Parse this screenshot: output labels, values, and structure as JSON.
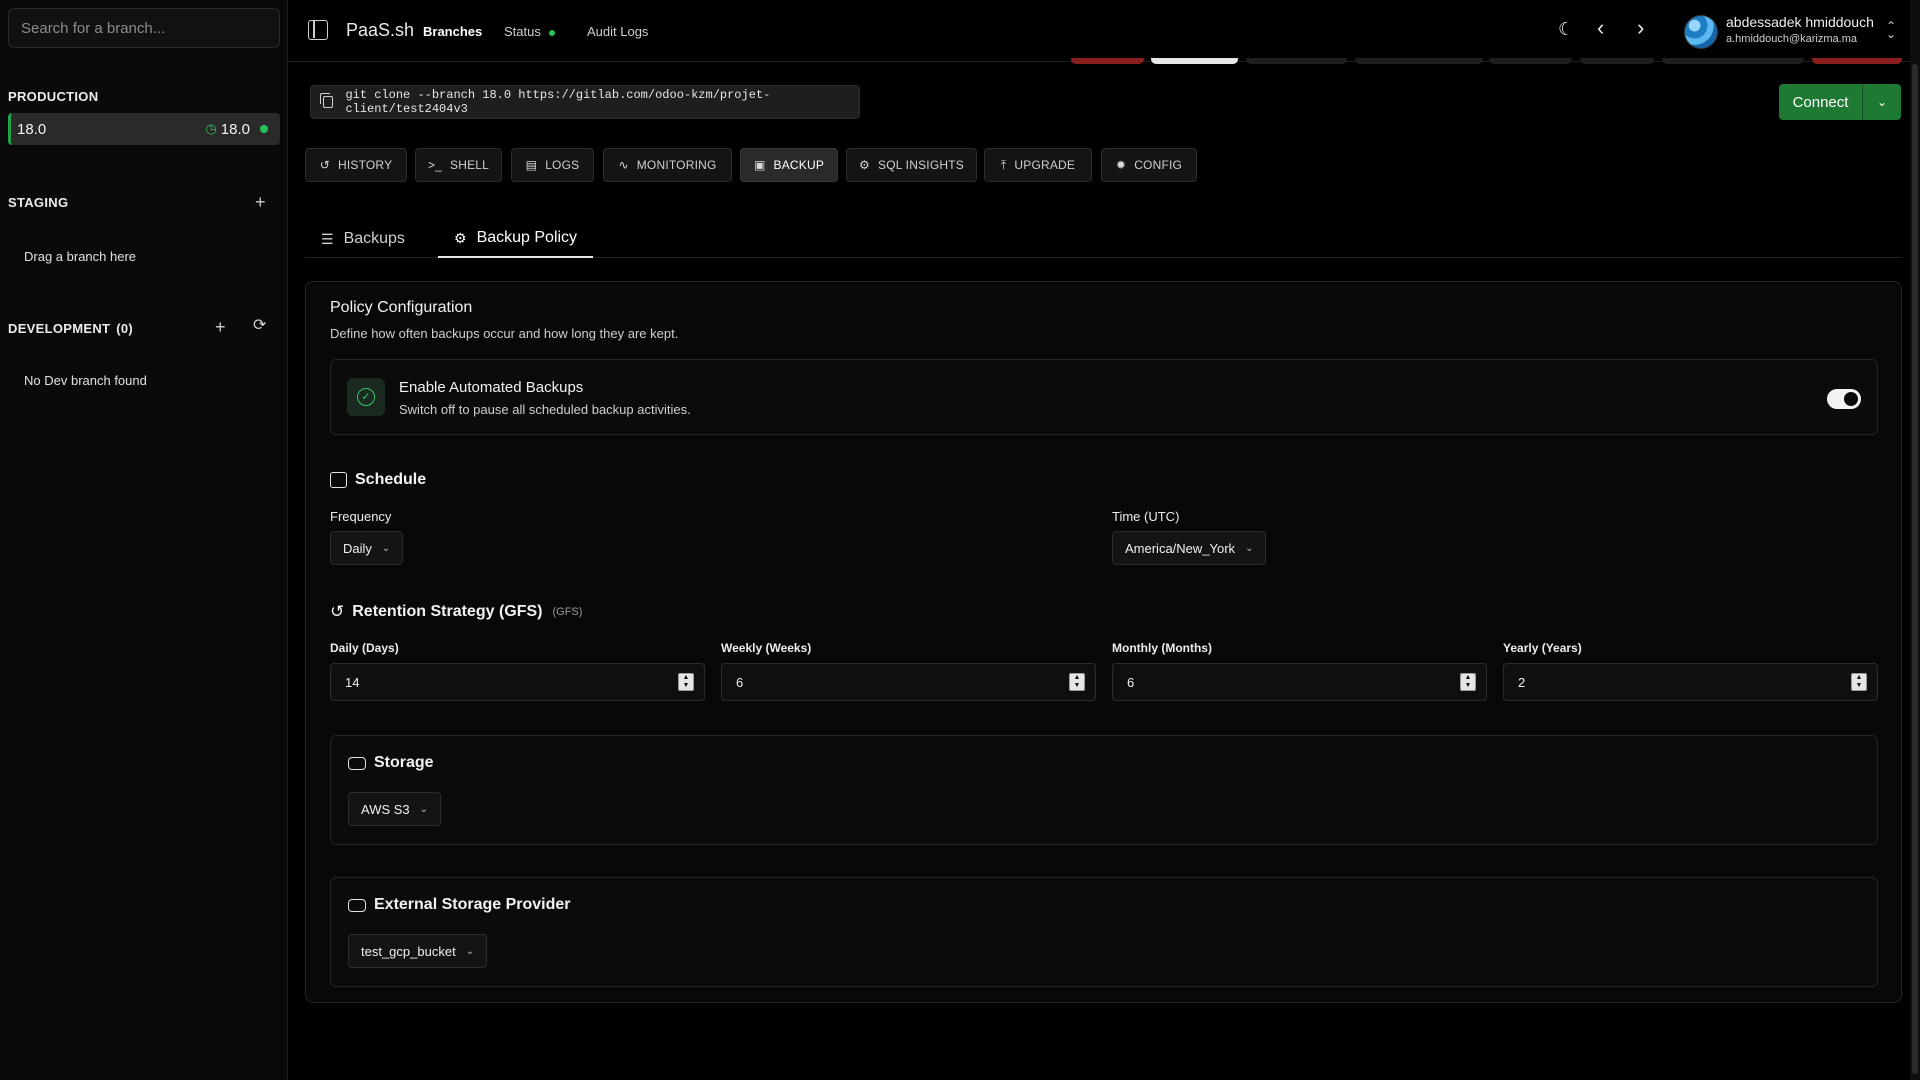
{
  "sidebar": {
    "search_placeholder": "Search for a branch...",
    "production": {
      "title": "PRODUCTION",
      "branch": "18.0",
      "version": "18.0"
    },
    "staging": {
      "title": "STAGING",
      "empty": "Drag a branch here"
    },
    "development": {
      "title": "DEVELOPMENT",
      "count": "(0)",
      "empty": "No Dev branch found"
    }
  },
  "topbar": {
    "brand": "PaaS.sh",
    "nav": [
      "Branches",
      "Status",
      "Audit Logs"
    ],
    "user_name": "abdessadek hmiddouch",
    "user_email": "a.hmiddouch@karizma.ma"
  },
  "git": {
    "command": "git clone --branch 18.0 https://gitlab.com/odoo-kzm/projet-client/test2404v3"
  },
  "connect": {
    "label": "Connect"
  },
  "tools": [
    "HISTORY",
    "SHELL",
    "LOGS",
    "MONITORING",
    "BACKUP",
    "SQL INSIGHTS",
    "UPGRADE",
    "CONFIG"
  ],
  "subtabs": [
    "Backups",
    "Backup Policy"
  ],
  "policy": {
    "title": "Policy Configuration",
    "subtitle": "Define how often backups occur and how long they are kept.",
    "auto_title": "Enable Automated Backups",
    "auto_sub": "Switch off to pause all scheduled backup activities.",
    "auto_enabled": true
  },
  "schedule": {
    "title": "Schedule",
    "frequency_label": "Frequency",
    "frequency_value": "Daily",
    "time_label": "Time (UTC)",
    "time_value": "America/New_York"
  },
  "retention": {
    "title": "Retention Strategy (GFS)",
    "tag": "(GFS)",
    "fields": [
      {
        "label": "Daily (Days)",
        "value": "14"
      },
      {
        "label": "Weekly (Weeks)",
        "value": "6"
      },
      {
        "label": "Monthly (Months)",
        "value": "6"
      },
      {
        "label": "Yearly (Years)",
        "value": "2"
      }
    ]
  },
  "storage": {
    "title": "Storage",
    "value": "AWS S3"
  },
  "external": {
    "title": "External Storage Provider",
    "value": "test_gcp_bucket"
  },
  "colors": {
    "accent_green": "#28c25a",
    "connect_green": "#1e7a33",
    "background": "#000000"
  }
}
